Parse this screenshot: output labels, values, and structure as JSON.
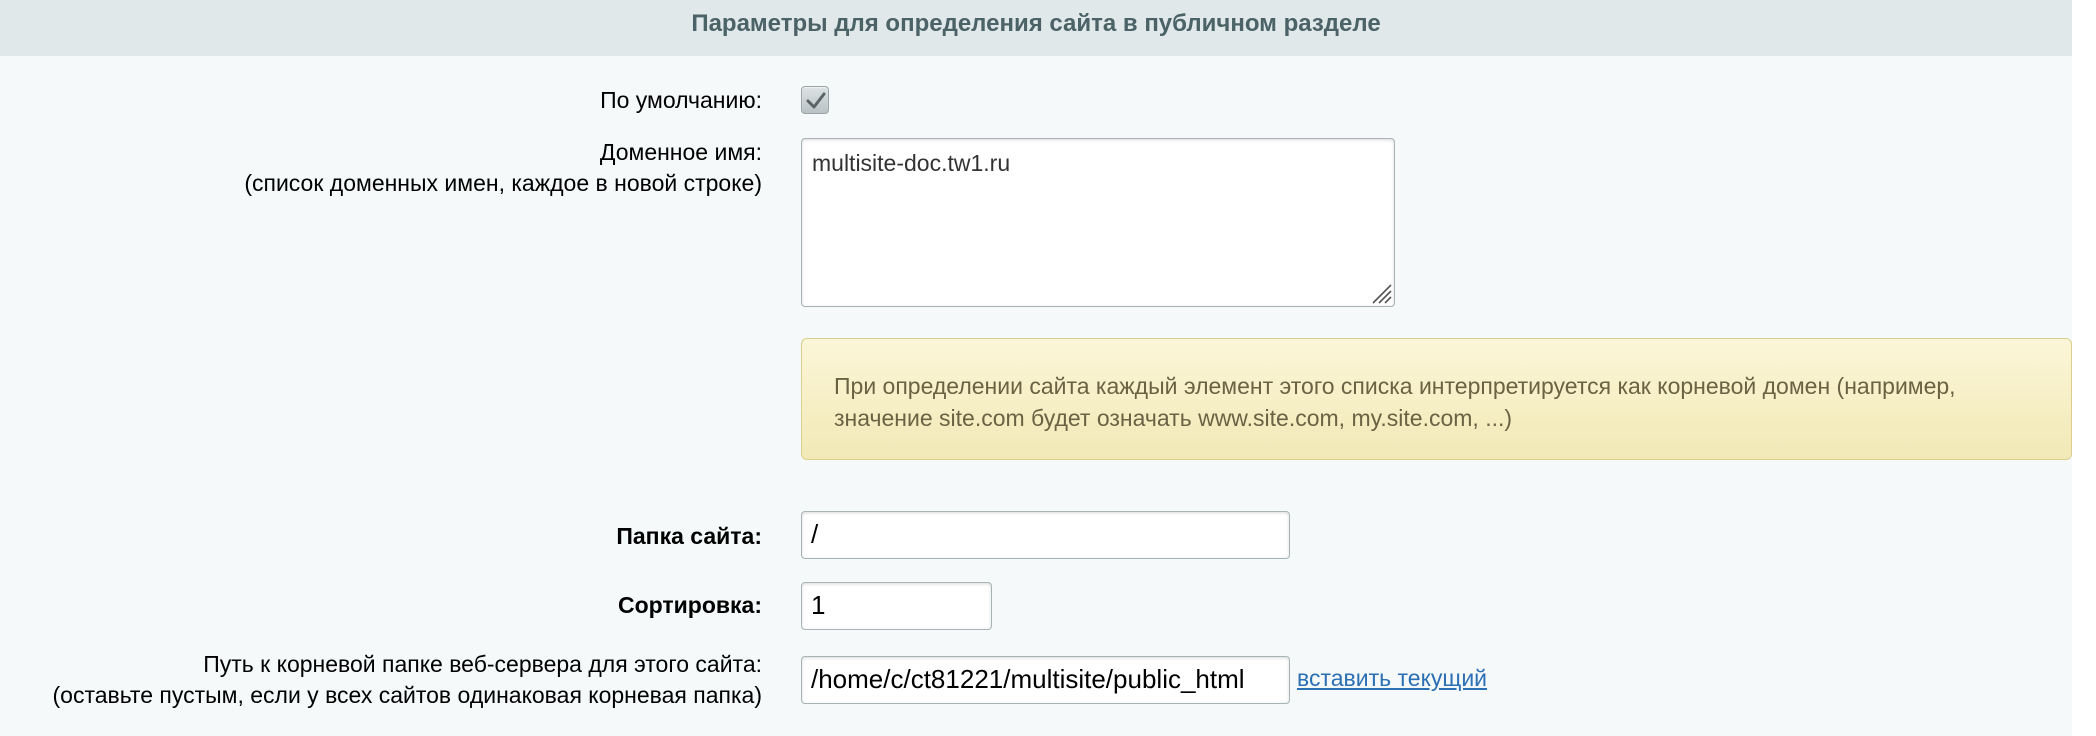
{
  "section": {
    "title": "Параметры для определения сайта в публичном разделе"
  },
  "fields": {
    "default": {
      "label": "По умолчанию:",
      "checked": true
    },
    "domain": {
      "label": "Доменное имя:",
      "sublabel": "(список доменных имен, каждое в новой строке)",
      "value": "multisite-doc.tw1.ru"
    },
    "domain_note": {
      "line1": "При определении сайта каждый элемент этого списка интерпретируется как корневой домен (например,",
      "line2": "значение site.com будет означать www.site.com, my.site.com, ...)"
    },
    "site_folder": {
      "label": "Папка сайта:",
      "value": "/"
    },
    "sort": {
      "label": "Сортировка:",
      "value": "1"
    },
    "doc_root": {
      "label": "Путь к корневой папке веб-сервера для этого сайта:",
      "sublabel": "(оставьте пустым, если у всех сайтов одинаковая корневая папка)",
      "value": "/home/c/ct81221/multisite/public_html",
      "insert_current_label": "вставить текущий"
    }
  }
}
